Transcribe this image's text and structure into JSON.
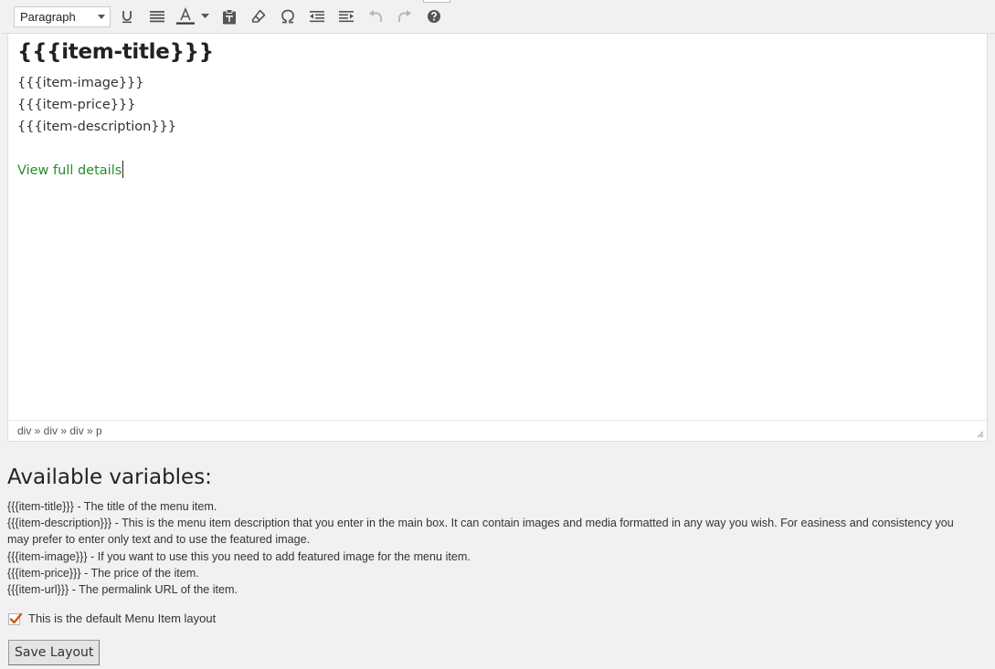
{
  "toolbar": {
    "format_value": "Paragraph",
    "buttons": [
      {
        "name": "underline-icon"
      },
      {
        "name": "justify-icon"
      },
      {
        "name": "text-color-icon"
      },
      {
        "name": "paste-text-icon"
      },
      {
        "name": "clear-formatting-icon"
      },
      {
        "name": "special-character-icon"
      },
      {
        "name": "outdent-icon"
      },
      {
        "name": "indent-icon"
      },
      {
        "name": "undo-icon"
      },
      {
        "name": "redo-icon"
      },
      {
        "name": "help-icon"
      }
    ],
    "text_color_swatch": "#333333"
  },
  "editor": {
    "heading": "{{{item-title}}}",
    "lines": [
      "{{{item-image}}}",
      "{{{item-price}}}",
      "{{{item-description}}}"
    ],
    "link_text": "View full details",
    "link_color": "#2a8a2a",
    "path": "div » div » div » p"
  },
  "variables": {
    "title": "Available variables:",
    "items": [
      "{{{item-title}}} - The title of the menu item.",
      "{{{item-description}}} - This is the menu item description that you enter in the main box. It can contain images and media formatted in any way you wish. For easiness and consistency you may prefer to enter only text and to use the featured image.",
      "{{{item-image}}} - If you want to use this you need to add featured image for the menu item.",
      "{{{item-price}}} - The price of the item.",
      "{{{item-url}}} - The permalink URL of the item."
    ]
  },
  "default_layout": {
    "label": "This is the default Menu Item layout",
    "checked": true,
    "check_color": "#d54e21"
  },
  "save_button": "Save Layout"
}
